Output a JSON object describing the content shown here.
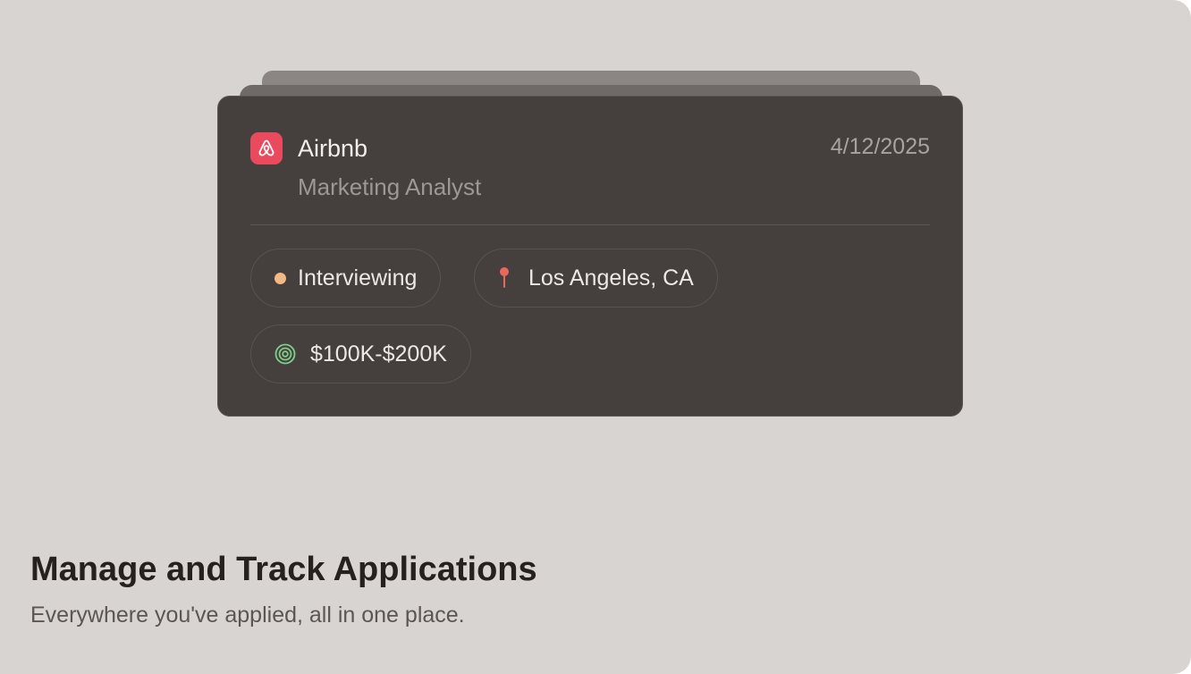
{
  "card": {
    "company": "Airbnb",
    "company_logo_icon": "airbnb-logo-icon",
    "role": "Marketing Analyst",
    "date": "4/12/2025",
    "status": {
      "label": "Interviewing",
      "icon": "status-dot-icon",
      "color": "#f2b985"
    },
    "location": {
      "label": "Los Angeles, CA",
      "icon": "map-pin-icon",
      "color": "#e8685a"
    },
    "salary": {
      "label": "$100K-$200K",
      "icon": "target-icon",
      "color": "#7fce8a"
    }
  },
  "feature": {
    "title": "Manage and Track Applications",
    "subtitle": "Everywhere you've applied, all in one place."
  },
  "colors": {
    "background": "#d8d4d1",
    "card": "#45403d",
    "brand_airbnb": "#ea4a5d"
  }
}
